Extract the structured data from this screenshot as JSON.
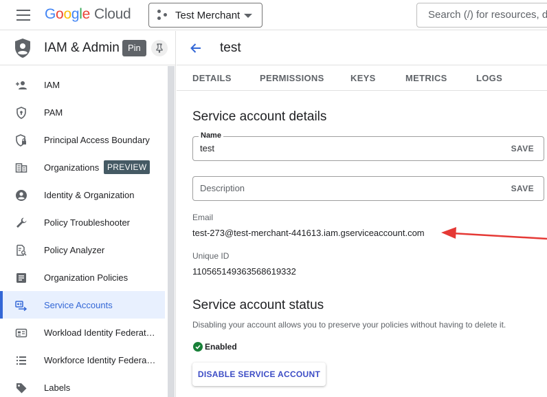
{
  "topbar": {
    "logo_letters": [
      "G",
      "o",
      "o",
      "g",
      "l",
      "e"
    ],
    "logo_product": "Cloud",
    "project_name": "Test Merchant",
    "search_placeholder": "Search (/) for resources, docs"
  },
  "sidebar": {
    "title": "IAM & Admin",
    "pin_label": "Pin",
    "items": [
      {
        "label": "IAM",
        "icon": "person-add-icon"
      },
      {
        "label": "PAM",
        "icon": "shield-key-icon"
      },
      {
        "label": "Principal Access Boundary",
        "icon": "shield-lock-icon"
      },
      {
        "label": "Organizations",
        "icon": "building-icon",
        "badge": "PREVIEW"
      },
      {
        "label": "Identity & Organization",
        "icon": "account-circle-icon"
      },
      {
        "label": "Policy Troubleshooter",
        "icon": "wrench-icon"
      },
      {
        "label": "Policy Analyzer",
        "icon": "document-search-icon"
      },
      {
        "label": "Organization Policies",
        "icon": "list-doc-icon"
      },
      {
        "label": "Service Accounts",
        "icon": "service-account-icon",
        "active": true
      },
      {
        "label": "Workload Identity Federat…",
        "icon": "id-card-icon"
      },
      {
        "label": "Workforce Identity Federa…",
        "icon": "list-icon"
      },
      {
        "label": "Labels",
        "icon": "tag-icon"
      }
    ]
  },
  "main": {
    "page_title": "test",
    "tabs": [
      "DETAILS",
      "PERMISSIONS",
      "KEYS",
      "METRICS",
      "LOGS"
    ],
    "details_title": "Service account details",
    "name_label": "Name",
    "name_value": "test",
    "save_label": "SAVE",
    "description_placeholder": "Description",
    "email_label": "Email",
    "email_value": "test-273@test-merchant-441613.iam.gserviceaccount.com",
    "unique_id_label": "Unique ID",
    "unique_id_value": "110565149363568619332",
    "status_title": "Service account status",
    "status_description": "Disabling your account allows you to preserve your policies without having to delete it.",
    "status_value": "Enabled",
    "disable_button": "DISABLE SERVICE ACCOUNT"
  },
  "colors": {
    "accent": "#3367d6",
    "enabled_green": "#188038",
    "annotation_arrow": "#e53935"
  }
}
